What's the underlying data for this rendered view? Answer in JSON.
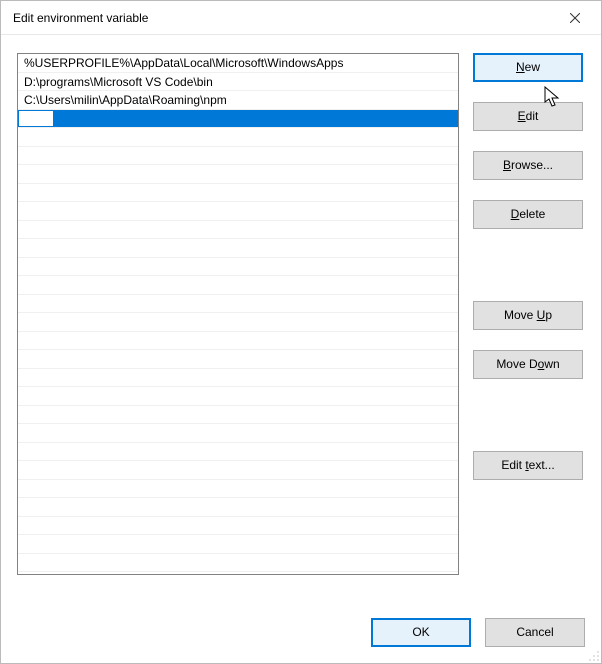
{
  "title": "Edit environment variable",
  "listItems": [
    "%USERPROFILE%\\AppData\\Local\\Microsoft\\WindowsApps",
    "D:\\programs\\Microsoft VS Code\\bin",
    "C:\\Users\\milin\\AppData\\Roaming\\npm"
  ],
  "selectedIndex": 3,
  "totalRows": 28,
  "buttons": {
    "new": "New",
    "edit": "Edit",
    "browse": "Browse...",
    "delete": "Delete",
    "moveUp": "Move Up",
    "moveDown": "Move Down",
    "editText": "Edit text...",
    "ok": "OK",
    "cancel": "Cancel"
  },
  "accelerators": {
    "new": "N",
    "edit": "E",
    "browse": "B",
    "delete": "D",
    "moveUp": "U",
    "moveDown": "o",
    "editText": "t"
  }
}
